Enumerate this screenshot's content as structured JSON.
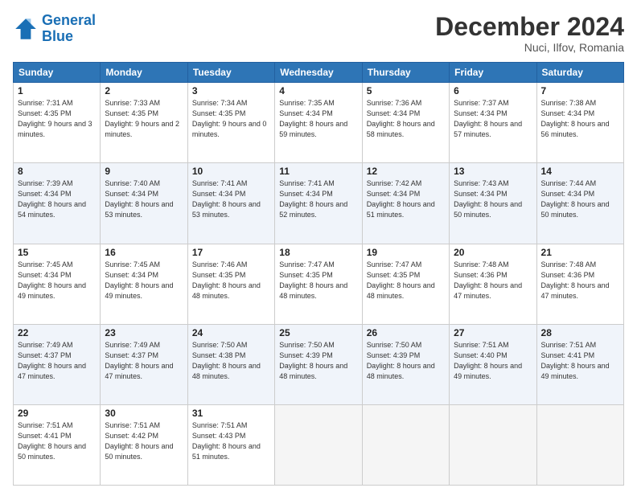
{
  "header": {
    "logo_line1": "General",
    "logo_line2": "Blue",
    "month": "December 2024",
    "location": "Nuci, Ilfov, Romania"
  },
  "weekdays": [
    "Sunday",
    "Monday",
    "Tuesday",
    "Wednesday",
    "Thursday",
    "Friday",
    "Saturday"
  ],
  "weeks": [
    [
      {
        "day": "1",
        "sunrise": "7:31 AM",
        "sunset": "4:35 PM",
        "daylight": "9 hours and 3 minutes."
      },
      {
        "day": "2",
        "sunrise": "7:33 AM",
        "sunset": "4:35 PM",
        "daylight": "9 hours and 2 minutes."
      },
      {
        "day": "3",
        "sunrise": "7:34 AM",
        "sunset": "4:35 PM",
        "daylight": "9 hours and 0 minutes."
      },
      {
        "day": "4",
        "sunrise": "7:35 AM",
        "sunset": "4:34 PM",
        "daylight": "8 hours and 59 minutes."
      },
      {
        "day": "5",
        "sunrise": "7:36 AM",
        "sunset": "4:34 PM",
        "daylight": "8 hours and 58 minutes."
      },
      {
        "day": "6",
        "sunrise": "7:37 AM",
        "sunset": "4:34 PM",
        "daylight": "8 hours and 57 minutes."
      },
      {
        "day": "7",
        "sunrise": "7:38 AM",
        "sunset": "4:34 PM",
        "daylight": "8 hours and 56 minutes."
      }
    ],
    [
      {
        "day": "8",
        "sunrise": "7:39 AM",
        "sunset": "4:34 PM",
        "daylight": "8 hours and 54 minutes."
      },
      {
        "day": "9",
        "sunrise": "7:40 AM",
        "sunset": "4:34 PM",
        "daylight": "8 hours and 53 minutes."
      },
      {
        "day": "10",
        "sunrise": "7:41 AM",
        "sunset": "4:34 PM",
        "daylight": "8 hours and 53 minutes."
      },
      {
        "day": "11",
        "sunrise": "7:41 AM",
        "sunset": "4:34 PM",
        "daylight": "8 hours and 52 minutes."
      },
      {
        "day": "12",
        "sunrise": "7:42 AM",
        "sunset": "4:34 PM",
        "daylight": "8 hours and 51 minutes."
      },
      {
        "day": "13",
        "sunrise": "7:43 AM",
        "sunset": "4:34 PM",
        "daylight": "8 hours and 50 minutes."
      },
      {
        "day": "14",
        "sunrise": "7:44 AM",
        "sunset": "4:34 PM",
        "daylight": "8 hours and 50 minutes."
      }
    ],
    [
      {
        "day": "15",
        "sunrise": "7:45 AM",
        "sunset": "4:34 PM",
        "daylight": "8 hours and 49 minutes."
      },
      {
        "day": "16",
        "sunrise": "7:45 AM",
        "sunset": "4:34 PM",
        "daylight": "8 hours and 49 minutes."
      },
      {
        "day": "17",
        "sunrise": "7:46 AM",
        "sunset": "4:35 PM",
        "daylight": "8 hours and 48 minutes."
      },
      {
        "day": "18",
        "sunrise": "7:47 AM",
        "sunset": "4:35 PM",
        "daylight": "8 hours and 48 minutes."
      },
      {
        "day": "19",
        "sunrise": "7:47 AM",
        "sunset": "4:35 PM",
        "daylight": "8 hours and 48 minutes."
      },
      {
        "day": "20",
        "sunrise": "7:48 AM",
        "sunset": "4:36 PM",
        "daylight": "8 hours and 47 minutes."
      },
      {
        "day": "21",
        "sunrise": "7:48 AM",
        "sunset": "4:36 PM",
        "daylight": "8 hours and 47 minutes."
      }
    ],
    [
      {
        "day": "22",
        "sunrise": "7:49 AM",
        "sunset": "4:37 PM",
        "daylight": "8 hours and 47 minutes."
      },
      {
        "day": "23",
        "sunrise": "7:49 AM",
        "sunset": "4:37 PM",
        "daylight": "8 hours and 47 minutes."
      },
      {
        "day": "24",
        "sunrise": "7:50 AM",
        "sunset": "4:38 PM",
        "daylight": "8 hours and 48 minutes."
      },
      {
        "day": "25",
        "sunrise": "7:50 AM",
        "sunset": "4:39 PM",
        "daylight": "8 hours and 48 minutes."
      },
      {
        "day": "26",
        "sunrise": "7:50 AM",
        "sunset": "4:39 PM",
        "daylight": "8 hours and 48 minutes."
      },
      {
        "day": "27",
        "sunrise": "7:51 AM",
        "sunset": "4:40 PM",
        "daylight": "8 hours and 49 minutes."
      },
      {
        "day": "28",
        "sunrise": "7:51 AM",
        "sunset": "4:41 PM",
        "daylight": "8 hours and 49 minutes."
      }
    ],
    [
      {
        "day": "29",
        "sunrise": "7:51 AM",
        "sunset": "4:41 PM",
        "daylight": "8 hours and 50 minutes."
      },
      {
        "day": "30",
        "sunrise": "7:51 AM",
        "sunset": "4:42 PM",
        "daylight": "8 hours and 50 minutes."
      },
      {
        "day": "31",
        "sunrise": "7:51 AM",
        "sunset": "4:43 PM",
        "daylight": "8 hours and 51 minutes."
      },
      null,
      null,
      null,
      null
    ]
  ]
}
